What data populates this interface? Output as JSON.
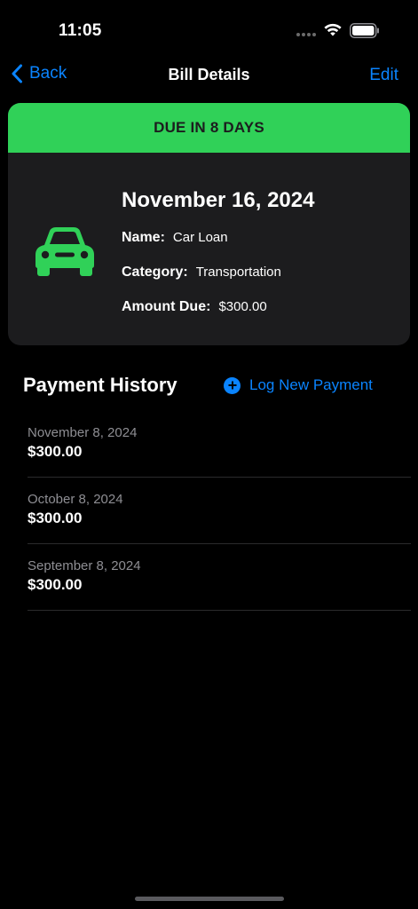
{
  "status_bar": {
    "time": "11:05"
  },
  "nav": {
    "back_label": "Back",
    "title": "Bill Details",
    "edit_label": "Edit"
  },
  "bill": {
    "due_banner": "DUE IN 8 DAYS",
    "due_date": "November 16, 2024",
    "name_label": "Name:",
    "name_value": "Car Loan",
    "category_label": "Category:",
    "category_value": "Transportation",
    "amount_label": "Amount Due:",
    "amount_value": "$300.00",
    "icon": "car-icon"
  },
  "history": {
    "title": "Payment History",
    "log_button_label": "Log New Payment",
    "payments": [
      {
        "date": "November 8, 2024",
        "amount": "$300.00"
      },
      {
        "date": "October 8, 2024",
        "amount": "$300.00"
      },
      {
        "date": "September 8, 2024",
        "amount": "$300.00"
      }
    ]
  },
  "colors": {
    "accent": "#0a84ff",
    "due_banner": "#30d158",
    "card": "#1c1c1e",
    "background": "#000000"
  }
}
